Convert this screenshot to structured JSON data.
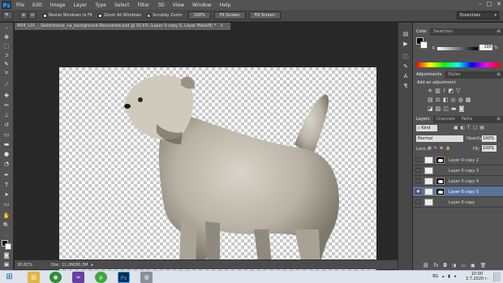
{
  "app": {
    "logo": "Ps"
  },
  "menu": [
    "File",
    "Edit",
    "Image",
    "Layer",
    "Type",
    "Select",
    "Filter",
    "3D",
    "View",
    "Window",
    "Help"
  ],
  "window_controls": {
    "minimize": "–",
    "restore": "□",
    "close": "✕"
  },
  "options_bar": {
    "resize_windows": "Resize Windows to Fit",
    "zoom_all": "Zoom All Windows",
    "scrubby_zoom": "Scrubby Zoom",
    "btn_100": "100%",
    "fit_screen": "Fit Screen",
    "fill_screen": "Fill Screen",
    "workspace": "Essentials"
  },
  "document": {
    "tab_title": "M04_L01_-_Selektiranje_na_background-Recovered.psd @ 30,6% (Layer 0 copy 5, Layer Mask/8) *",
    "tab_close": "×"
  },
  "status": {
    "zoom": "30,61%",
    "doc": "Doc: 11,0M/80,3M"
  },
  "color_panel": {
    "tabs": [
      "Color",
      "Swatches"
    ],
    "k_label": "K",
    "k_value": "100",
    "k_unit": "%"
  },
  "adjustments_panel": {
    "tabs": [
      "Adjustments",
      "Styles"
    ],
    "heading": "Add an adjustment"
  },
  "layers_panel": {
    "tabs": [
      "Layers",
      "Channels",
      "Paths"
    ],
    "filter": "Kind",
    "blend_mode": "Normal",
    "opacity_label": "Opacity:",
    "opacity": "100%",
    "lock_label": "Lock:",
    "fill_label": "Fill:",
    "fill": "100%",
    "layers": [
      {
        "name": "Layer 0 copy 2",
        "visible": false,
        "selected": false,
        "has_mask": true
      },
      {
        "name": "Layer 0 copy 3",
        "visible": false,
        "selected": false,
        "has_mask": false
      },
      {
        "name": "Layer 0 copy 4",
        "visible": false,
        "selected": false,
        "has_mask": true
      },
      {
        "name": "Layer 0 copy 5",
        "visible": true,
        "selected": true,
        "has_mask": true
      },
      {
        "name": "Layer 0 copy",
        "visible": false,
        "selected": false,
        "has_mask": false
      }
    ]
  },
  "taskbar": {
    "apps": [
      "windows-start",
      "explorer",
      "chrome",
      "visual-studio",
      "utorrent",
      "photoshop",
      "tool"
    ],
    "tray_lang": "BG",
    "time": "10:00",
    "date": "3.7.2020 г."
  },
  "colors": {
    "accent": "#39a0ff",
    "selected_layer": "#5a7397",
    "panel": "#535353"
  }
}
